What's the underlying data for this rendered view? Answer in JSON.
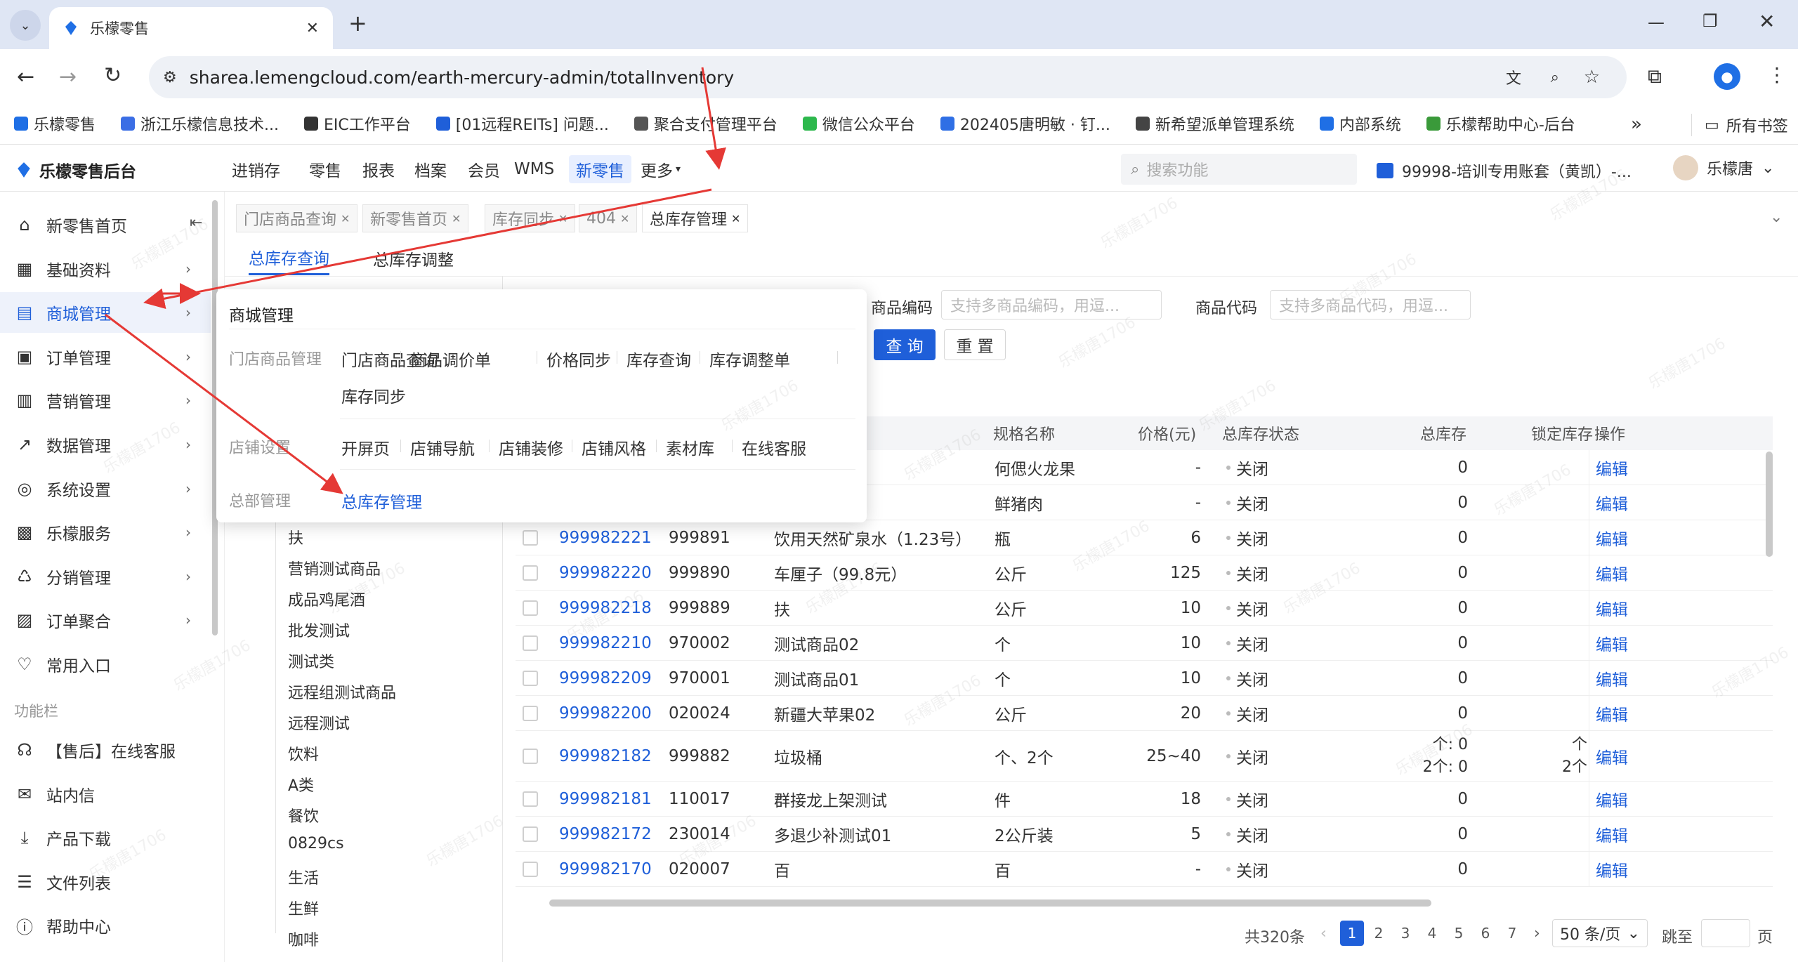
{
  "browser": {
    "tab_title": "乐檬零售",
    "url": "sharea.lemengcloud.com/earth-mercury-admin/totalInventory",
    "bookmarks": [
      "乐檬零售",
      "浙江乐檬信息技术...",
      "EIC工作平台",
      "[01远程REITs] 问题...",
      "聚合支付管理平台",
      "微信公众平台",
      "202405唐明敏 · 钉...",
      "新希望派单管理系统",
      "内部系统",
      "乐檬帮助中心-后台"
    ],
    "all_bookmarks": "所有书签"
  },
  "app": {
    "logo": "乐檬零售后台",
    "nav": [
      "进销存",
      "零售",
      "报表",
      "档案",
      "会员",
      "WMS",
      "新零售",
      "更多"
    ],
    "search_placeholder": "搜索功能",
    "account": "99998-培训专用账套（黄凯）-...",
    "user": "乐檬唐"
  },
  "sidebar": {
    "items": [
      "新零售首页",
      "基础资料",
      "商城管理",
      "订单管理",
      "营销管理",
      "数据管理",
      "系统设置",
      "乐檬服务",
      "分销管理",
      "订单聚合",
      "常用入口"
    ],
    "section_label": "功能栏",
    "tools": [
      "【售后】在线客服",
      "站内信",
      "产品下载",
      "文件列表",
      "帮助中心"
    ]
  },
  "page_tabs": [
    "门店商品查询",
    "新零售首页",
    "库存同步",
    "404",
    "总库存管理"
  ],
  "sub_tabs": [
    "总库存查询",
    "总库存调整"
  ],
  "filters": {
    "code_label": "商品编码",
    "code_placeholder": "支持多商品编码，用逗...",
    "sku_label": "商品代码",
    "sku_placeholder": "支持多商品代码，用逗...",
    "query": "查 询",
    "reset": "重 置"
  },
  "flyout": {
    "title": "商城管理",
    "groups": [
      {
        "label": "门店商品管理",
        "items": [
          "门店商品查询",
          "商品调价单",
          "价格同步",
          "库存查询",
          "库存调整单",
          "库存同步"
        ]
      },
      {
        "label": "店铺设置",
        "items": [
          "开屏页",
          "店铺导航",
          "店铺装修",
          "店铺风格",
          "素材库",
          "在线客服"
        ]
      },
      {
        "label": "总部管理",
        "items": [
          "总库存管理"
        ]
      }
    ]
  },
  "tree": [
    "扶",
    "营销测试商品",
    "成品鸡尾酒",
    "批发测试",
    "测试类",
    "远程组测试商品",
    "远程测试",
    "饮料",
    "A类",
    "餐饮",
    "0829cs",
    "生活",
    "生鲜",
    "咖啡"
  ],
  "table": {
    "headers": [
      "规格名称",
      "价格(元)",
      "总库存状态",
      "总库存",
      "锁定库存",
      "操作"
    ],
    "rows": [
      {
        "code": "",
        "sku": "",
        "name": "",
        "spec": "何偲火龙果",
        "price": "-",
        "status": "关闭",
        "stock": "0",
        "locked": "",
        "op": "编辑"
      },
      {
        "code": "",
        "sku": "",
        "name": "",
        "spec": "鲜猪肉",
        "price": "-",
        "status": "关闭",
        "stock": "0",
        "locked": "",
        "op": "编辑"
      },
      {
        "code": "999982221",
        "sku": "999891",
        "name": "饮用天然矿泉水（1.23号）",
        "spec": "瓶",
        "price": "6",
        "status": "关闭",
        "stock": "0",
        "locked": "",
        "op": "编辑"
      },
      {
        "code": "999982220",
        "sku": "999890",
        "name": "车厘子（99.8元）",
        "spec": "公斤",
        "price": "125",
        "status": "关闭",
        "stock": "0",
        "locked": "",
        "op": "编辑"
      },
      {
        "code": "999982218",
        "sku": "999889",
        "name": "扶",
        "spec": "公斤",
        "price": "10",
        "status": "关闭",
        "stock": "0",
        "locked": "",
        "op": "编辑"
      },
      {
        "code": "999982210",
        "sku": "970002",
        "name": "测试商品02",
        "spec": "个",
        "price": "10",
        "status": "关闭",
        "stock": "0",
        "locked": "",
        "op": "编辑"
      },
      {
        "code": "999982209",
        "sku": "970001",
        "name": "测试商品01",
        "spec": "个",
        "price": "10",
        "status": "关闭",
        "stock": "0",
        "locked": "",
        "op": "编辑"
      },
      {
        "code": "999982200",
        "sku": "020024",
        "name": "新疆大苹果02",
        "spec": "公斤",
        "price": "20",
        "status": "关闭",
        "stock": "0",
        "locked": "",
        "op": "编辑"
      },
      {
        "code": "999982182",
        "sku": "999882",
        "name": "垃圾桶",
        "spec": "个、2个",
        "price": "25~40",
        "status": "关闭",
        "stock": "个: 0",
        "stock2": "2个: 0",
        "locked": "个",
        "locked2": "2个",
        "op": "编辑"
      },
      {
        "code": "999982181",
        "sku": "110017",
        "name": "群接龙上架测试",
        "spec": "件",
        "price": "18",
        "status": "关闭",
        "stock": "0",
        "locked": "",
        "op": "编辑"
      },
      {
        "code": "999982172",
        "sku": "230014",
        "name": "多退少补测试01",
        "spec": "2公斤装",
        "price": "5",
        "status": "关闭",
        "stock": "0",
        "locked": "",
        "op": "编辑"
      },
      {
        "code": "999982170",
        "sku": "020007",
        "name": "百",
        "spec": "百",
        "price": "-",
        "status": "关闭",
        "stock": "0",
        "locked": "",
        "op": "编辑"
      }
    ]
  },
  "pagination": {
    "total": "共320条",
    "pages": [
      "1",
      "2",
      "3",
      "4",
      "5",
      "6",
      "7"
    ],
    "page_size": "50 条/页",
    "goto": "跳至",
    "page_unit": "页"
  },
  "watermark": "乐檬唐1706",
  "colors": {
    "accent": "#1f5fd9",
    "arrow": "#e53935",
    "tabstrip": "#dfe6f4"
  }
}
